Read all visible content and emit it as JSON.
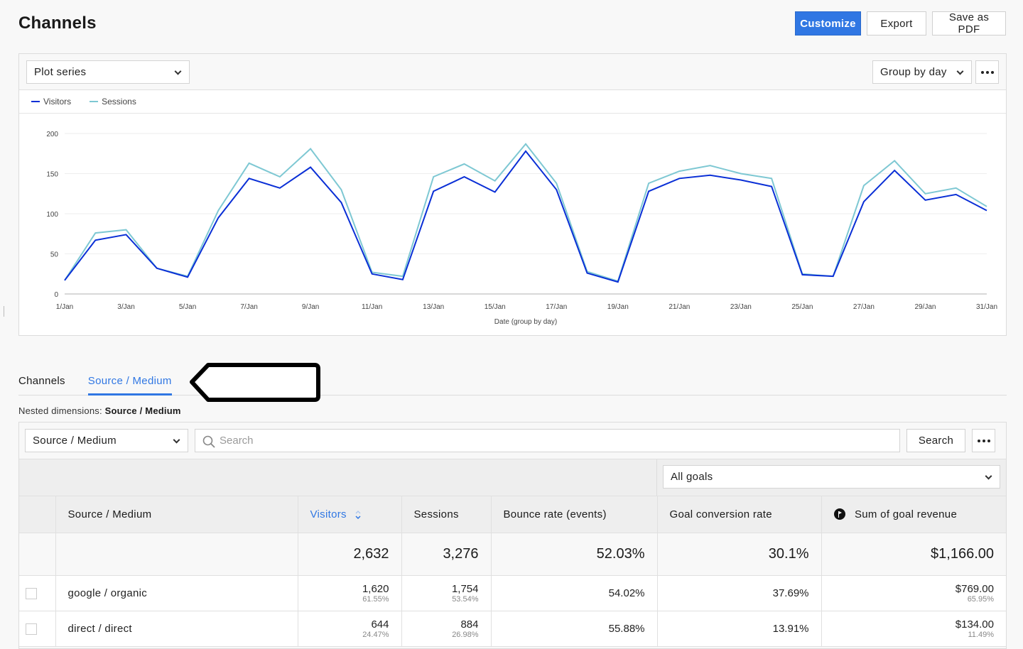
{
  "header": {
    "title": "Channels",
    "buttons": {
      "customize": "Customize",
      "export": "Export",
      "save_pdf": "Save as PDF"
    }
  },
  "chart_panel": {
    "plot_series_select": "Plot series",
    "group_by_select": "Group by day",
    "more_icon": "ellipsis-icon"
  },
  "chart_data": {
    "type": "line",
    "title": "",
    "xlabel": "Date (group by day)",
    "ylabel": "",
    "ylim": [
      0,
      200
    ],
    "yticks": [
      0,
      50,
      100,
      150,
      200
    ],
    "grid": true,
    "legend_position": "top-left",
    "x": [
      "1/Jan",
      "2/Jan",
      "3/Jan",
      "4/Jan",
      "5/Jan",
      "6/Jan",
      "7/Jan",
      "8/Jan",
      "9/Jan",
      "10/Jan",
      "11/Jan",
      "12/Jan",
      "13/Jan",
      "14/Jan",
      "15/Jan",
      "16/Jan",
      "17/Jan",
      "18/Jan",
      "19/Jan",
      "20/Jan",
      "21/Jan",
      "22/Jan",
      "23/Jan",
      "24/Jan",
      "25/Jan",
      "26/Jan",
      "27/Jan",
      "28/Jan",
      "29/Jan",
      "30/Jan",
      "31/Jan"
    ],
    "xtick_labels": [
      "1/Jan",
      "3/Jan",
      "5/Jan",
      "7/Jan",
      "9/Jan",
      "11/Jan",
      "13/Jan",
      "15/Jan",
      "17/Jan",
      "19/Jan",
      "21/Jan",
      "23/Jan",
      "25/Jan",
      "27/Jan",
      "29/Jan",
      "31/Jan"
    ],
    "series": [
      {
        "name": "Visitors",
        "color": "#0a2fd6",
        "values": [
          17,
          67,
          74,
          32,
          21,
          95,
          144,
          132,
          158,
          114,
          25,
          18,
          128,
          146,
          127,
          178,
          130,
          26,
          15,
          128,
          144,
          148,
          142,
          134,
          24,
          22,
          115,
          154,
          117,
          124,
          104
        ]
      },
      {
        "name": "Sessions",
        "color": "#7ec8d3",
        "values": [
          17,
          76,
          80,
          32,
          22,
          104,
          163,
          146,
          181,
          130,
          27,
          22,
          146,
          162,
          141,
          187,
          138,
          28,
          16,
          138,
          153,
          160,
          150,
          144,
          25,
          22,
          135,
          166,
          125,
          132,
          109
        ]
      }
    ]
  },
  "tabs": [
    {
      "label": "Channels",
      "active": false
    },
    {
      "label": "Source / Medium",
      "active": true
    }
  ],
  "nested_dimensions": {
    "label": "Nested dimensions:",
    "value": "Source / Medium"
  },
  "table_panel": {
    "dimension_select": "Source / Medium",
    "search_placeholder": "Search",
    "search_value": "",
    "search_button": "Search",
    "goals_select": "All goals"
  },
  "table": {
    "columns": [
      "",
      "Source / Medium",
      "Visitors",
      "Sessions",
      "Bounce rate (events)",
      "Goal conversion rate",
      "Sum of goal revenue"
    ],
    "sorted_column": "Visitors",
    "totals": {
      "visitors": "2,632",
      "sessions": "3,276",
      "bounce_rate": "52.03%",
      "goal_conversion": "30.1%",
      "goal_revenue": "$1,166.00"
    },
    "rows": [
      {
        "name": "google / organic",
        "visitors": "1,620",
        "visitors_pct": "61.55%",
        "sessions": "1,754",
        "sessions_pct": "53.54%",
        "bounce_rate": "54.02%",
        "goal_conversion": "37.69%",
        "goal_revenue": "$769.00",
        "goal_revenue_pct": "65.95%"
      },
      {
        "name": "direct / direct",
        "visitors": "644",
        "visitors_pct": "24.47%",
        "sessions": "884",
        "sessions_pct": "26.98%",
        "bounce_rate": "55.88%",
        "goal_conversion": "13.91%",
        "goal_revenue": "$134.00",
        "goal_revenue_pct": "11.49%"
      }
    ]
  },
  "colors": {
    "accent": "#3077e3",
    "visitors_line": "#0a2fd6",
    "sessions_line": "#7ec8d3"
  }
}
